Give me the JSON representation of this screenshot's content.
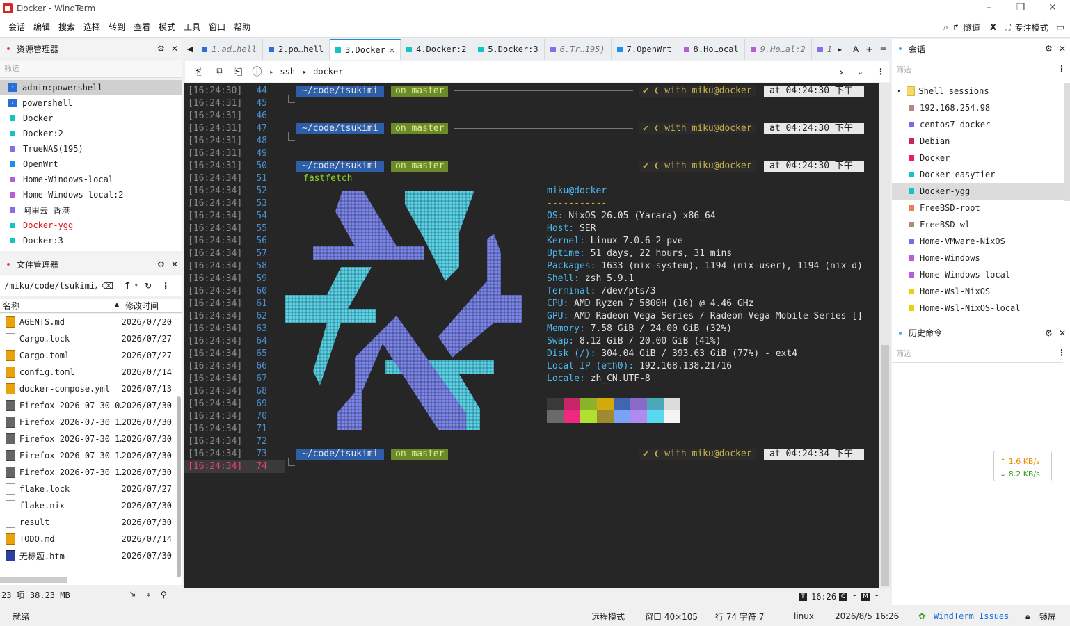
{
  "app": {
    "title": "Docker - WindTerm"
  },
  "window": {
    "minimize": "–",
    "maximize": "❐",
    "close": "✕"
  },
  "menu": [
    "会话",
    "编辑",
    "搜索",
    "选择",
    "转到",
    "查看",
    "模式",
    "工具",
    "窗口",
    "帮助"
  ],
  "menu_right": {
    "tunnel": "隧道",
    "focus": "专注模式"
  },
  "explorer": {
    "title": "资源管理器",
    "filter_placeholder": "筛选",
    "sessions": [
      {
        "label": "admin:powershell",
        "color": "#2a6fd6",
        "icon": "powershell-icon",
        "selected": true
      },
      {
        "label": "powershell",
        "color": "#2a6fd6",
        "icon": "powershell-icon"
      },
      {
        "label": "Docker",
        "color": "#14c4c4"
      },
      {
        "label": "Docker:2",
        "color": "#14c4c4"
      },
      {
        "label": "TrueNAS(195)",
        "color": "#8a6ce8"
      },
      {
        "label": "OpenWrt",
        "color": "#1e8ef0"
      },
      {
        "label": "Home-Windows-local",
        "color": "#b85cd8"
      },
      {
        "label": "Home-Windows-local:2",
        "color": "#b85cd8"
      },
      {
        "label": "阿里云-香港",
        "color": "#8a6ce8"
      },
      {
        "label": "Docker-ygg",
        "color": "#14c4c4",
        "red": true
      },
      {
        "label": "Docker:3",
        "color": "#14c4c4"
      }
    ]
  },
  "filemanager": {
    "title": "文件管理器",
    "path": "/miku/code/tsukimi/",
    "col_name": "名称",
    "col_time": "修改时间",
    "files": [
      {
        "name": "AGENTS.md",
        "date": "2026/07/20",
        "kind": "sub"
      },
      {
        "name": "Cargo.lock",
        "date": "2026/07/27",
        "kind": "plain"
      },
      {
        "name": "Cargo.toml",
        "date": "2026/07/27",
        "kind": "sub"
      },
      {
        "name": "config.toml",
        "date": "2026/07/14",
        "kind": "sub"
      },
      {
        "name": "docker-compose.yml",
        "date": "2026/07/13",
        "kind": "sub"
      },
      {
        "name": "Firefox 2026-07-30 0…",
        "date": "2026/07/30",
        "kind": "ff"
      },
      {
        "name": "Firefox 2026-07-30 1…",
        "date": "2026/07/30",
        "kind": "ff"
      },
      {
        "name": "Firefox 2026-07-30 1…",
        "date": "2026/07/30",
        "kind": "ff"
      },
      {
        "name": "Firefox 2026-07-30 1…",
        "date": "2026/07/30",
        "kind": "ff"
      },
      {
        "name": "Firefox 2026-07-30 1…",
        "date": "2026/07/30",
        "kind": "ff"
      },
      {
        "name": "flake.lock",
        "date": "2026/07/27",
        "kind": "plain"
      },
      {
        "name": "flake.nix",
        "date": "2026/07/30",
        "kind": "plain"
      },
      {
        "name": "result",
        "date": "2026/07/30",
        "kind": "plain"
      },
      {
        "name": "TODO.md",
        "date": "2026/07/14",
        "kind": "sub"
      },
      {
        "name": "无标题.htm",
        "date": "2026/07/30",
        "kind": "htm"
      }
    ],
    "summary": "23 项 38.23 MB"
  },
  "tabs": [
    {
      "label": "1.ad…hell",
      "color": "#2a6fd6",
      "italic": true
    },
    {
      "label": "2.po…hell",
      "color": "#2a6fd6"
    },
    {
      "label": "3.Docker",
      "color": "#14c4c4",
      "active": true
    },
    {
      "label": "4.Docker:2",
      "color": "#14c4c4"
    },
    {
      "label": "5.Docker:3",
      "color": "#14c4c4"
    },
    {
      "label": "6.Tr…195)",
      "color": "#8a6ce8",
      "italic": true
    },
    {
      "label": "7.OpenWrt",
      "color": "#1e8ef0"
    },
    {
      "label": "8.Ho…ocal",
      "color": "#b85cd8"
    },
    {
      "label": "9.Ho…al:2",
      "color": "#b85cd8",
      "italic": true
    },
    {
      "label": "1",
      "color": "#8a6ce8",
      "italic": true
    }
  ],
  "address": {
    "protocol": "ssh",
    "host": "docker"
  },
  "terminal": {
    "prompt": {
      "path": "~/code/tsukimi",
      "git": "on master",
      "with": "✔ ❮ with miku@docker"
    },
    "lines": [
      {
        "ts": "[16:24:30]",
        "n": "44",
        "kind": "prompt",
        "at": "at 04:24:30 下午"
      },
      {
        "ts": "[16:24:31]",
        "n": "45",
        "kind": "cont"
      },
      {
        "ts": "[16:24:31]",
        "n": "46",
        "kind": "blank"
      },
      {
        "ts": "[16:24:31]",
        "n": "47",
        "kind": "prompt",
        "at": "at 04:24:30 下午"
      },
      {
        "ts": "[16:24:31]",
        "n": "48",
        "kind": "cont"
      },
      {
        "ts": "[16:24:31]",
        "n": "49",
        "kind": "blank"
      },
      {
        "ts": "[16:24:31]",
        "n": "50",
        "kind": "prompt",
        "at": "at 04:24:30 下午"
      },
      {
        "ts": "[16:24:34]",
        "n": "51",
        "kind": "cmd",
        "cmd": "fastfetch"
      },
      {
        "ts": "[16:24:34]",
        "n": "52",
        "kind": "blank"
      },
      {
        "ts": "[16:24:34]",
        "n": "53",
        "kind": "blank"
      },
      {
        "ts": "[16:24:34]",
        "n": "54",
        "kind": "blank"
      },
      {
        "ts": "[16:24:34]",
        "n": "55",
        "kind": "blank"
      },
      {
        "ts": "[16:24:34]",
        "n": "56",
        "kind": "blank"
      },
      {
        "ts": "[16:24:34]",
        "n": "57",
        "kind": "blank"
      },
      {
        "ts": "[16:24:34]",
        "n": "58",
        "kind": "blank"
      },
      {
        "ts": "[16:24:34]",
        "n": "59",
        "kind": "blank"
      },
      {
        "ts": "[16:24:34]",
        "n": "60",
        "kind": "blank"
      },
      {
        "ts": "[16:24:34]",
        "n": "61",
        "kind": "blank"
      },
      {
        "ts": "[16:24:34]",
        "n": "62",
        "kind": "blank"
      },
      {
        "ts": "[16:24:34]",
        "n": "63",
        "kind": "blank"
      },
      {
        "ts": "[16:24:34]",
        "n": "64",
        "kind": "blank"
      },
      {
        "ts": "[16:24:34]",
        "n": "65",
        "kind": "blank"
      },
      {
        "ts": "[16:24:34]",
        "n": "66",
        "kind": "blank"
      },
      {
        "ts": "[16:24:34]",
        "n": "67",
        "kind": "blank"
      },
      {
        "ts": "[16:24:34]",
        "n": "68",
        "kind": "blank"
      },
      {
        "ts": "[16:24:34]",
        "n": "69",
        "kind": "blank"
      },
      {
        "ts": "[16:24:34]",
        "n": "70",
        "kind": "blank"
      },
      {
        "ts": "[16:24:34]",
        "n": "71",
        "kind": "blank"
      },
      {
        "ts": "[16:24:34]",
        "n": "72",
        "kind": "blank"
      },
      {
        "ts": "[16:24:34]",
        "n": "73",
        "kind": "prompt",
        "at": "at 04:24:34 下午"
      },
      {
        "ts": "[16:24:34]",
        "n": "74",
        "kind": "cont",
        "current": true
      }
    ],
    "fastfetch": {
      "header": "miku@docker",
      "rule": "-----------",
      "rows": [
        [
          "OS: ",
          "NixOS 26.05 (Yarara) x86_64"
        ],
        [
          "Host: ",
          "SER"
        ],
        [
          "Kernel: ",
          "Linux 7.0.6-2-pve"
        ],
        [
          "Uptime: ",
          "51 days, 22 hours, 31 mins"
        ],
        [
          "Packages: ",
          "1633 (nix-system), 1194 (nix-user), 1194 (nix-d)"
        ],
        [
          "Shell: ",
          "zsh 5.9.1"
        ],
        [
          "Terminal: ",
          "/dev/pts/3"
        ],
        [
          "CPU: ",
          "AMD Ryzen 7 5800H (16) @ 4.46 GHz"
        ],
        [
          "GPU: ",
          "AMD Radeon Vega Series / Radeon Vega Mobile Series []"
        ],
        [
          "Memory: ",
          "7.58 GiB / 24.00 GiB (32%)"
        ],
        [
          "Swap: ",
          "8.12 GiB / 20.00 GiB (41%)"
        ],
        [
          "Disk (/): ",
          "304.04 GiB / 393.63 GiB (77%) - ext4"
        ],
        [
          "Local IP (eth0): ",
          "192.168.138.21/16"
        ],
        [
          "Locale: ",
          "zh_CN.UTF-8"
        ]
      ],
      "palette_top": [
        "#3a3a3a",
        "#c8256b",
        "#8bb22a",
        "#d4a90c",
        "#3d68b0",
        "#8a6ac8",
        "#4aa8b8",
        "#dcdcdc"
      ],
      "palette_bottom": [
        "#6a6a6a",
        "#f02880",
        "#b0e030",
        "#a08a30",
        "#7aa2f7",
        "#b08af0",
        "#5ad8f0",
        "#f4f4f4"
      ]
    },
    "footer": {
      "time": "16:26",
      "t": "T",
      "c": "C",
      "m": "M"
    }
  },
  "sessions_panel": {
    "title": "会话",
    "filter_placeholder": "筛选",
    "items": [
      {
        "label": "Shell sessions",
        "color": "#f6d96a",
        "folder": true
      },
      {
        "label": "192.168.254.98",
        "color": "#b08a80"
      },
      {
        "label": "centos7-docker",
        "color": "#7a6ce8"
      },
      {
        "label": "Debian",
        "color": "#c8256b"
      },
      {
        "label": "Docker",
        "color": "#e81e6a"
      },
      {
        "label": "Docker-easytier",
        "color": "#14c4c4"
      },
      {
        "label": "Docker-ygg",
        "color": "#14c4c4",
        "selected": true
      },
      {
        "label": "FreeBSD-root",
        "color": "#f08050"
      },
      {
        "label": "FreeBSD-wl",
        "color": "#b08a80"
      },
      {
        "label": "Home-VMware-NixOS",
        "color": "#7a6ce8"
      },
      {
        "label": "Home-Windows",
        "color": "#b85cd8"
      },
      {
        "label": "Home-Windows-local",
        "color": "#b85cd8"
      },
      {
        "label": "Home-Wsl-NixOS",
        "color": "#e8d00c"
      },
      {
        "label": "Home-Wsl-NixOS-local",
        "color": "#e8d00c"
      }
    ]
  },
  "history_panel": {
    "title": "历史命令",
    "filter_placeholder": "筛选"
  },
  "netspeed": {
    "up": "↑ 1.6 KB/s",
    "down": "↓ 8.2 KB/s"
  },
  "status": {
    "ready": "就绪",
    "mode": "远程模式",
    "window": "窗口 40×105",
    "position": "行 74 字符 7",
    "os": "linux",
    "datetime": "2026/8/5 16:26",
    "issues": "WindTerm Issues",
    "lock": "锁屏"
  }
}
